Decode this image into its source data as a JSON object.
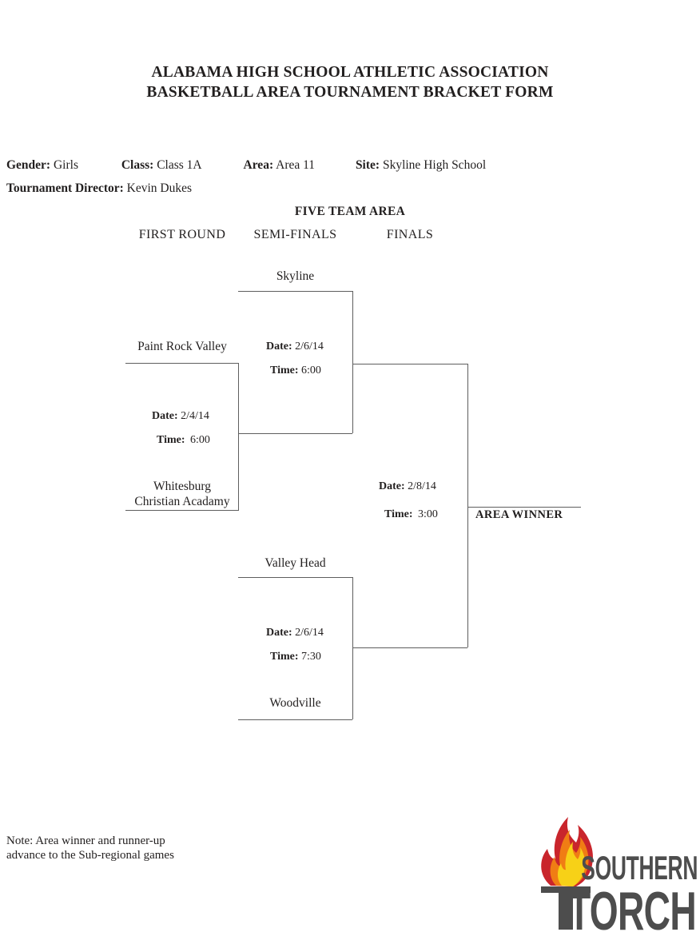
{
  "document": {
    "title_line_1": "ALABAMA HIGH SCHOOL ATHLETIC ASSOCIATION",
    "title_line_2": "BASKETBALL AREA TOURNAMENT BRACKET FORM",
    "section_heading": "FIVE TEAM AREA",
    "note": "Note: Area winner and runner-up\nadvance to the Sub-regional games"
  },
  "meta": {
    "gender_label": "Gender:",
    "gender_value": "Girls",
    "class_label": "Class:",
    "class_value": "Class 1A",
    "area_label": "Area:",
    "area_value": "Area 11",
    "site_label": "Site:",
    "site_value": "Skyline High School",
    "director_label": "Tournament Director:",
    "director_value": "Kevin Dukes"
  },
  "rounds": {
    "first": "FIRST ROUND",
    "semi": "SEMI-FINALS",
    "finals": "FINALS"
  },
  "bracket": {
    "area_winner_label": "AREA WINNER",
    "date_label": "Date:",
    "time_label": "Time:",
    "teams": {
      "skyline": "Skyline",
      "paint_rock_valley": "Paint Rock Valley",
      "whitesburg_line1": "Whitesburg",
      "whitesburg_line2": "Christian Acadamy",
      "valley_head": "Valley Head",
      "woodville": "Woodville"
    },
    "games": {
      "first_round": {
        "date": "2/4/14",
        "time": "6:00"
      },
      "semi_upper": {
        "date": "2/6/14",
        "time": "6:00"
      },
      "semi_lower": {
        "date": "2/6/14",
        "time": "7:30"
      },
      "finals": {
        "date": "2/8/14",
        "time": "3:00"
      }
    }
  },
  "logo": {
    "word_top": "SOUTHERN",
    "word_bottom": "TORCH",
    "text_color": "#4d4d4d",
    "flame_outer_color": "#c9252c",
    "flame_mid_color": "#f07d14",
    "flame_inner_color": "#f7d117"
  },
  "colors": {
    "line": "#5e5e5e",
    "text": "#221f1f",
    "page_background": "#ffffff"
  }
}
